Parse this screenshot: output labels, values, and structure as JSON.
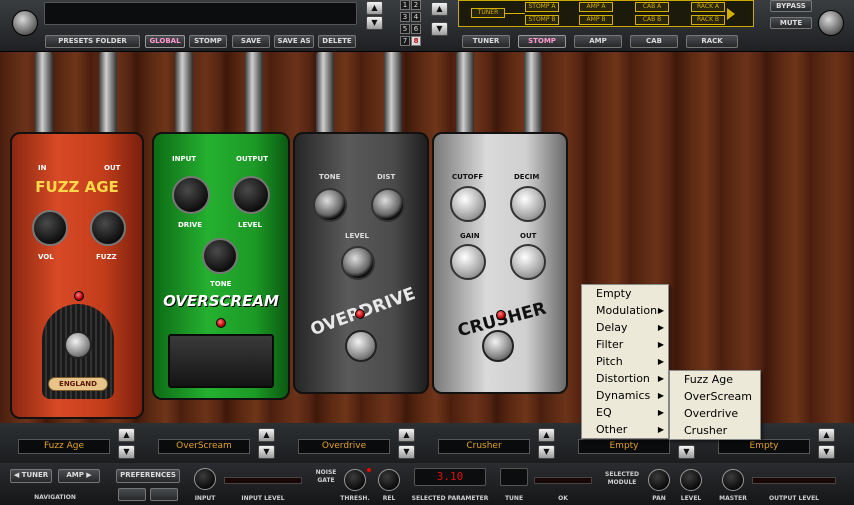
{
  "topbar": {
    "preset_name": "",
    "buttons": [
      "PRESETS FOLDER",
      "GLOBAL",
      "STOMP",
      "SAVE",
      "SAVE AS",
      "DELETE"
    ],
    "active_button": "GLOBAL",
    "slot_numbers": [
      "1",
      "2",
      "3",
      "4",
      "5",
      "6",
      "7",
      "8"
    ],
    "selected_slot": "8",
    "up_arrow": "▲",
    "down_arrow": "▼",
    "chain": {
      "tuner": "TUNER",
      "boxes": [
        "STOMP A",
        "STOMP B",
        "AMP A",
        "AMP B",
        "CAB A",
        "CAB B",
        "RACK A",
        "RACK B"
      ]
    },
    "nav_tabs": [
      "TUNER",
      "STOMP",
      "AMP",
      "CAB",
      "RACK"
    ],
    "active_tab": "STOMP",
    "bypass": "BYPASS",
    "mute": "MUTE"
  },
  "pedals": {
    "fuzz": {
      "in": "IN",
      "out": "OUT",
      "title": "FUZZ AGE",
      "knob1": "VOL",
      "knob2": "FUZZ",
      "badge": "ENGLAND"
    },
    "overscream": {
      "input": "INPUT",
      "output": "OUTPUT",
      "drive": "DRIVE",
      "level": "LEVEL",
      "tone": "TONE",
      "title": "OVERSCREAM"
    },
    "overdrive": {
      "tone": "TONE",
      "dist": "DIST",
      "level": "LEVEL",
      "title": "OVERDRIVE"
    },
    "crusher": {
      "cutoff": "CUTOFF",
      "decim": "DECIM",
      "gain": "GAIN",
      "out": "OUT",
      "title": "CRUSHER"
    }
  },
  "slots": [
    "Fuzz Age",
    "OverScream",
    "Overdrive",
    "Crusher",
    "Empty",
    "Empty"
  ],
  "context_menu": {
    "items": [
      {
        "label": "Empty",
        "arrow": ""
      },
      {
        "label": "Modulation",
        "arrow": "▶"
      },
      {
        "label": "Delay",
        "arrow": "▶"
      },
      {
        "label": "Filter",
        "arrow": "▶"
      },
      {
        "label": "Pitch",
        "arrow": "▶"
      },
      {
        "label": "Distortion",
        "arrow": "▶"
      },
      {
        "label": "Dynamics",
        "arrow": "▶"
      },
      {
        "label": "EQ",
        "arrow": "▶"
      },
      {
        "label": "Other",
        "arrow": "▶"
      }
    ],
    "submenu": [
      "Fuzz Age",
      "OverScream",
      "Overdrive",
      "Crusher"
    ]
  },
  "bottom": {
    "tuner_btn": "◀ TUNER",
    "amp_btn": "AMP ▶",
    "navigation": "NAVIGATION",
    "preferences": "PREFERENCES",
    "input": "INPUT",
    "input_level": "INPUT LEVEL",
    "noise": "NOISE",
    "gate": "GATE",
    "thresh": "THRESH.",
    "rel": "REL",
    "param_value": "3.10",
    "selected_parameter": "SELECTED PARAMETER",
    "tune": "TUNE",
    "ok": "OK",
    "selected": "SELECTED",
    "module": "MODULE",
    "pan": "PAN",
    "level": "LEVEL",
    "master": "MASTER",
    "output_level": "OUTPUT LEVEL"
  },
  "colors": {
    "slot_text": "#e1a12a",
    "chain_accent": "#d4b000",
    "fuzz": "#c8381a",
    "overscream": "#1fa22a"
  }
}
